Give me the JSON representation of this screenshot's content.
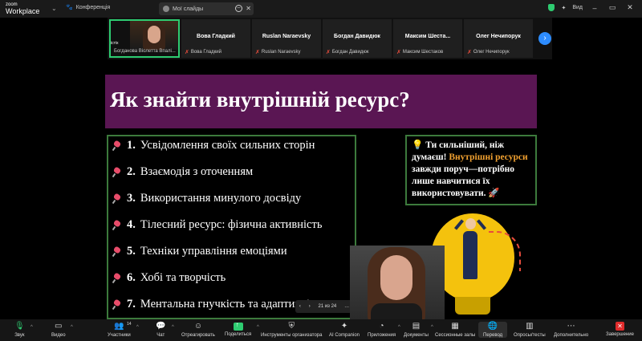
{
  "topbar": {
    "app_small": "zoom",
    "app_big": "Workplace",
    "meeting_label": "Конференція",
    "share_title": "Мої слайды",
    "view_label": "Вид"
  },
  "participants": [
    {
      "name": "",
      "caption": "Богданова Віолетта Впалі...",
      "overlay": "істіх",
      "muted": false,
      "active": true
    },
    {
      "name": "Вова Гладкий",
      "caption": "Вова Гладкий",
      "muted": true
    },
    {
      "name": "Ruslan Naraevsky",
      "caption": "Ruslan Naraevsky",
      "muted": true
    },
    {
      "name": "Богдан Давидюк",
      "caption": "Богдан Давидюк",
      "muted": true
    },
    {
      "name": "Максим  Шеста...",
      "caption": "Максим Шестаков",
      "muted": true
    },
    {
      "name": "Олег Нечипорук",
      "caption": "Олег Нечипорук",
      "muted": true
    }
  ],
  "slide": {
    "title": "Як знайти внутрішній ресурс?",
    "items": [
      {
        "num": "1.",
        "text": "Усвідомлення своїх сильних сторін"
      },
      {
        "num": "2.",
        "text": "Взаємодія з оточенням"
      },
      {
        "num": "3.",
        "text": "Використання минулого досвіду"
      },
      {
        "num": "4.",
        "text": "Тілесний ресурс: фізична активність"
      },
      {
        "num": "5.",
        "text": "Техніки управління емоціями"
      },
      {
        "num": "6.",
        "text": "Хобі та творчість"
      },
      {
        "num": "7.",
        "text": "Ментальна гнучкість та адаптивність"
      }
    ],
    "callout_part1": "Ти сильніший, ніж думаєш!",
    "callout_highlight": "Внутрішні ресурси",
    "callout_part2": "завжди поруч—потрібно лише навчитися їх використовувати."
  },
  "page_counter": {
    "text": "21 из 24"
  },
  "toolbar": {
    "audio": "Звук",
    "video": "Видео",
    "participants": "Участники",
    "participants_count": "14",
    "chat": "Чат",
    "react": "Отреагировать",
    "share": "Поделиться",
    "host_tools": "Инструменты организатора",
    "ai": "AI Companion",
    "apps": "Приложения",
    "docs": "Документы",
    "rooms": "Сессионные залы",
    "translate": "Перевод",
    "polls": "Опросы/тесты",
    "more": "Дополнительно",
    "end": "Завершение"
  }
}
